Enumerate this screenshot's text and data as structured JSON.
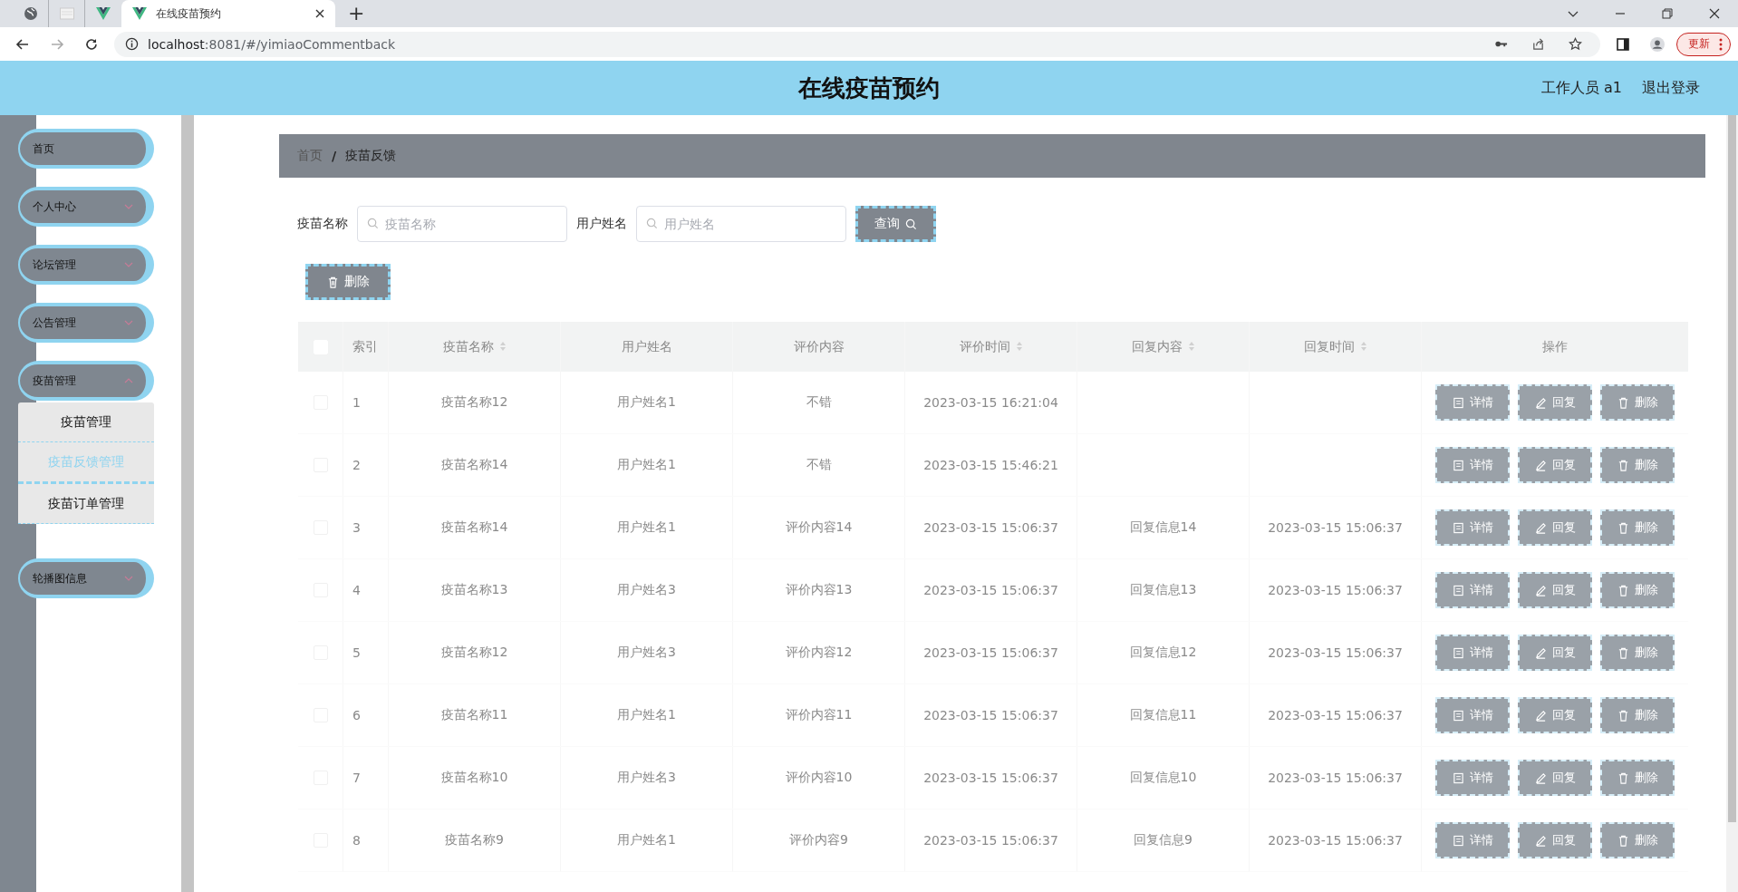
{
  "browser": {
    "tabs": [
      {
        "kind": "globe",
        "selected": false
      },
      {
        "kind": "page",
        "selected": false
      },
      {
        "kind": "vue",
        "selected": false
      },
      {
        "kind": "vue",
        "title": "在线疫苗预约",
        "selected": true
      }
    ],
    "new_tab": "+",
    "url_host": "localhost",
    "url_rest": ":8081/#/yimiaoCommentback",
    "update_button": "更新"
  },
  "header": {
    "title": "在线疫苗预约",
    "user": "工作人员 a1",
    "logout": "退出登录"
  },
  "sidebar": {
    "items": [
      {
        "label": "首页",
        "has_arrow": false
      },
      {
        "label": "个人中心",
        "has_arrow": true,
        "expanded": false
      },
      {
        "label": "论坛管理",
        "has_arrow": true,
        "expanded": false
      },
      {
        "label": "公告管理",
        "has_arrow": true,
        "expanded": false
      },
      {
        "label": "疫苗管理",
        "has_arrow": true,
        "expanded": true,
        "children": [
          {
            "label": "疫苗管理",
            "selected": false
          },
          {
            "label": "疫苗反馈管理",
            "selected": true
          },
          {
            "label": "疫苗订单管理",
            "selected": false
          }
        ]
      },
      {
        "label": "轮播图信息",
        "has_arrow": true,
        "expanded": false
      }
    ]
  },
  "breadcrumb": {
    "items": [
      "首页",
      "疫苗反馈"
    ],
    "separator": "/"
  },
  "search": {
    "fields": [
      {
        "label": "疫苗名称",
        "placeholder": "疫苗名称"
      },
      {
        "label": "用户姓名",
        "placeholder": "用户姓名"
      }
    ],
    "button": "查询"
  },
  "delete_button": "删除",
  "table": {
    "select_all": {
      "checked": false
    },
    "columns": [
      {
        "label": "索引",
        "sortable": false
      },
      {
        "label": "疫苗名称",
        "sortable": true
      },
      {
        "label": "用户姓名",
        "sortable": false
      },
      {
        "label": "评价内容",
        "sortable": false
      },
      {
        "label": "评价时间",
        "sortable": true
      },
      {
        "label": "回复内容",
        "sortable": true
      },
      {
        "label": "回复时间",
        "sortable": true
      },
      {
        "label": "操作",
        "sortable": false
      }
    ],
    "rows": [
      {
        "checked": false,
        "cells": [
          "1",
          "疫苗名称12",
          "用户姓名1",
          "不错",
          "2023-03-15 16:21:04",
          "",
          ""
        ],
        "actions": [
          "详情",
          "回复",
          "删除"
        ]
      },
      {
        "checked": false,
        "cells": [
          "2",
          "疫苗名称14",
          "用户姓名1",
          "不错",
          "2023-03-15 15:46:21",
          "",
          ""
        ],
        "actions": [
          "详情",
          "回复",
          "删除"
        ]
      },
      {
        "checked": false,
        "cells": [
          "3",
          "疫苗名称14",
          "用户姓名1",
          "评价内容14",
          "2023-03-15 15:06:37",
          "回复信息14",
          "2023-03-15 15:06:37"
        ],
        "actions": [
          "详情",
          "回复",
          "删除"
        ]
      },
      {
        "checked": false,
        "cells": [
          "4",
          "疫苗名称13",
          "用户姓名3",
          "评价内容13",
          "2023-03-15 15:06:37",
          "回复信息13",
          "2023-03-15 15:06:37"
        ],
        "actions": [
          "详情",
          "回复",
          "删除"
        ]
      },
      {
        "checked": false,
        "cells": [
          "5",
          "疫苗名称12",
          "用户姓名3",
          "评价内容12",
          "2023-03-15 15:06:37",
          "回复信息12",
          "2023-03-15 15:06:37"
        ],
        "actions": [
          "详情",
          "回复",
          "删除"
        ]
      },
      {
        "checked": false,
        "cells": [
          "6",
          "疫苗名称11",
          "用户姓名1",
          "评价内容11",
          "2023-03-15 15:06:37",
          "回复信息11",
          "2023-03-15 15:06:37"
        ],
        "actions": [
          "详情",
          "回复",
          "删除"
        ]
      },
      {
        "checked": false,
        "cells": [
          "7",
          "疫苗名称10",
          "用户姓名3",
          "评价内容10",
          "2023-03-15 15:06:37",
          "回复信息10",
          "2023-03-15 15:06:37"
        ],
        "actions": [
          "详情",
          "回复",
          "删除"
        ]
      },
      {
        "checked": false,
        "cells": [
          "8",
          "疫苗名称9",
          "用户姓名1",
          "评价内容9",
          "2023-03-15 15:06:37",
          "回复信息9",
          "2023-03-15 15:06:37"
        ],
        "actions": [
          "详情",
          "回复",
          "删除"
        ]
      }
    ]
  }
}
